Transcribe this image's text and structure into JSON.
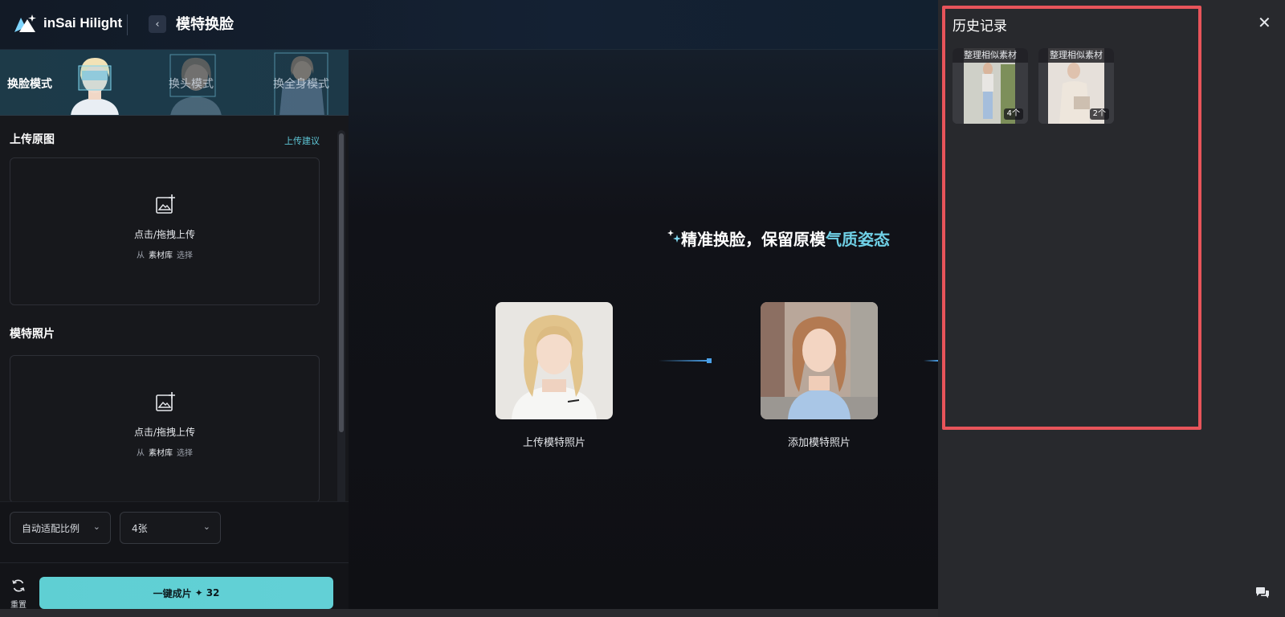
{
  "app": {
    "logo_text": "inSai Hilight",
    "page_title": "模特换脸",
    "back_glyph": "‹"
  },
  "modes": [
    {
      "label": "换脸模式",
      "active": true
    },
    {
      "label": "换头模式",
      "active": false
    },
    {
      "label": "换全身模式",
      "active": false
    }
  ],
  "upload_original": {
    "title": "上传原图",
    "tip": "上传建议",
    "label": "点击/拖拽上传",
    "from": "从",
    "library": "素材库",
    "choose": "选择"
  },
  "model_photo": {
    "title": "模特照片",
    "label": "点击/拖拽上传",
    "from": "从",
    "library": "素材库",
    "choose": "选择"
  },
  "options": {
    "ratio": "自动适配比例",
    "count": "4张"
  },
  "actions": {
    "reset": "重置",
    "generate": "一键成片",
    "cost_icon": "✦",
    "cost": "32"
  },
  "center": {
    "headline_main": "精准换脸，保留原模",
    "headline_accent": "气质姿态",
    "steps": [
      {
        "caption": "上传模特照片"
      },
      {
        "caption": "添加模特照片"
      }
    ]
  },
  "history": {
    "title": "历史记录",
    "close": "✕",
    "items": [
      {
        "label": "整理相似素材",
        "count": "4个"
      },
      {
        "label": "整理相似素材",
        "count": "2个"
      }
    ]
  },
  "colors": {
    "accent": "#5fcfd3",
    "highlight": "#e8545a",
    "headline_accent": "#6fd0e6"
  },
  "icons": [
    "logo-icon",
    "back-icon",
    "image-add-icon",
    "chevron-down-icon",
    "refresh-icon",
    "sparkle-icon",
    "close-icon",
    "chat-icon"
  ]
}
